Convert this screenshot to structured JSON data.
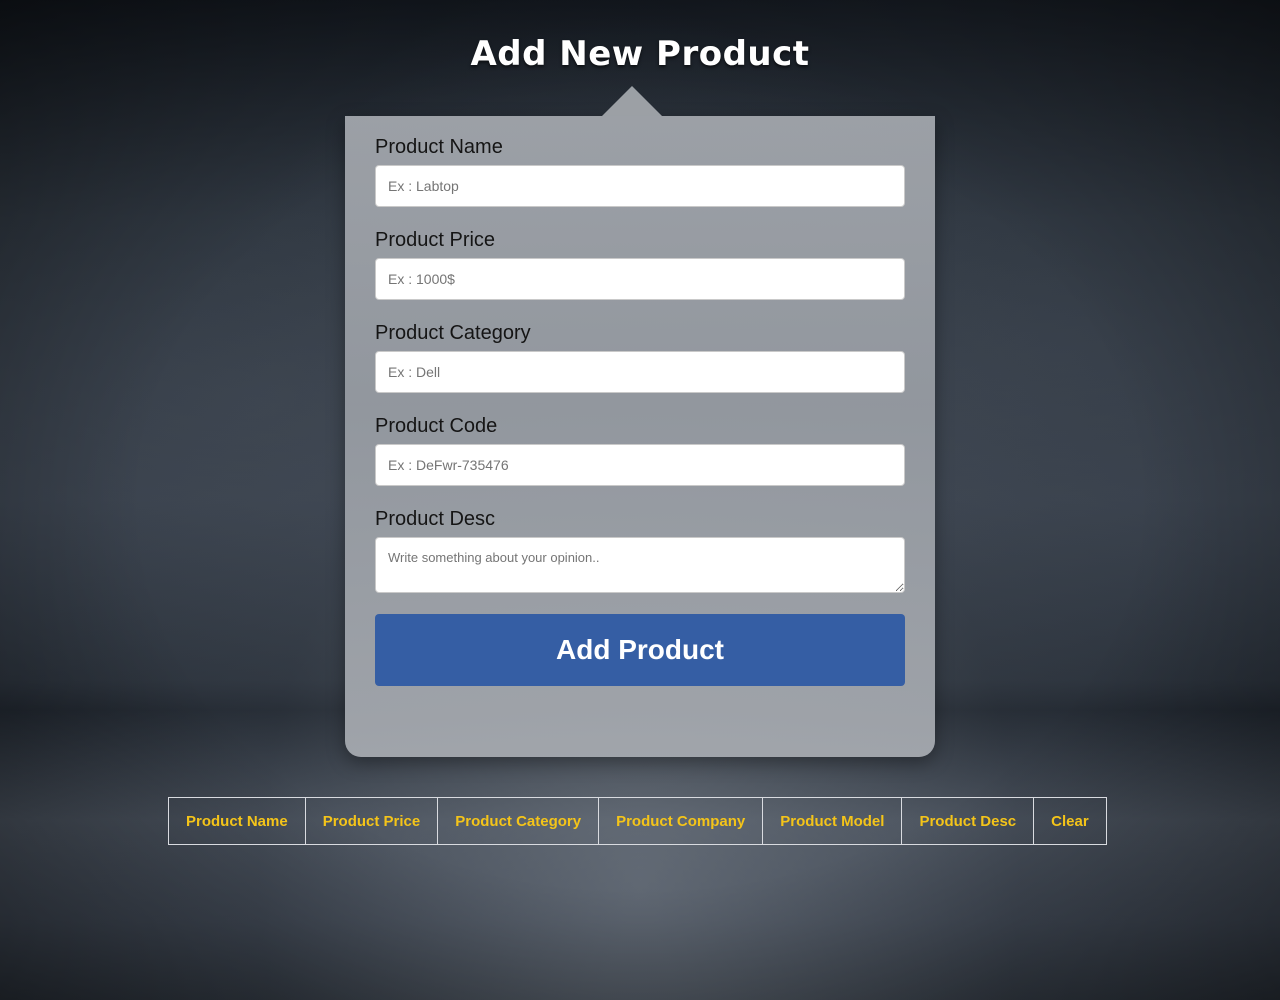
{
  "page": {
    "title": "Add New Product"
  },
  "form": {
    "fields": [
      {
        "label": "Product Name",
        "placeholder": "Ex : Labtop",
        "value": ""
      },
      {
        "label": "Product Price",
        "placeholder": "Ex : 1000$",
        "value": ""
      },
      {
        "label": "Product Category",
        "placeholder": "Ex : Dell",
        "value": ""
      },
      {
        "label": "Product Code",
        "placeholder": "Ex : DeFwr-735476",
        "value": ""
      }
    ],
    "desc": {
      "label": "Product Desc",
      "placeholder": "Write something about your opinion..",
      "value": ""
    },
    "submit_label": "Add Product"
  },
  "table": {
    "headers": [
      "Product Name",
      "Product Price",
      "Product Category",
      "Product Company",
      "Product Model",
      "Product Desc",
      "Clear"
    ]
  },
  "colors": {
    "button_bg": "#355ea4",
    "table_header_text": "#f4c419",
    "card_bg": "#a2a6ac"
  }
}
